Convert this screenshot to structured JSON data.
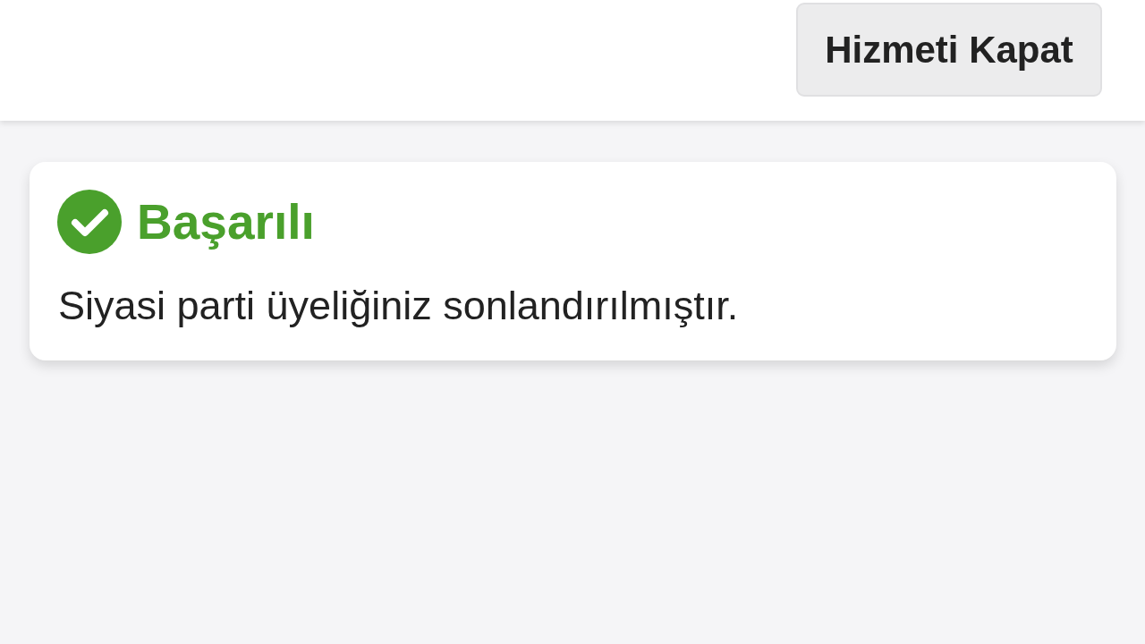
{
  "header": {
    "button": {
      "label": "Hizmeti Kapat"
    }
  },
  "alert": {
    "kind": "success",
    "title": "Başarılı",
    "message": "Siyasi parti üyeliğiniz sonlandırılmıştır."
  }
}
